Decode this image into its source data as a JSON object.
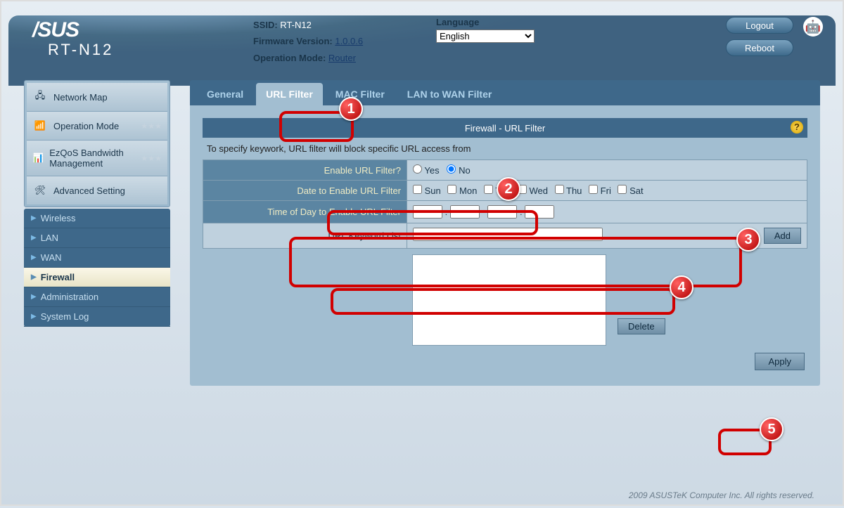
{
  "brand": "/SUS",
  "model": "RT-N12",
  "header": {
    "ssid_label": "SSID:",
    "ssid_value": "RT-N12",
    "fw_label": "Firmware Version:",
    "fw_value": "1.0.0.6",
    "mode_label": "Operation Mode:",
    "mode_value": "Router",
    "lang_label": "Language",
    "lang_value": "English",
    "logout": "Logout",
    "reboot": "Reboot"
  },
  "sidebar": {
    "items": [
      {
        "label": "Network Map"
      },
      {
        "label": "Operation Mode"
      },
      {
        "label": "EzQoS Bandwidth Management"
      },
      {
        "label": "Advanced Setting"
      }
    ],
    "sub": [
      {
        "label": "Wireless"
      },
      {
        "label": "LAN"
      },
      {
        "label": "WAN"
      },
      {
        "label": "Firewall"
      },
      {
        "label": "Administration"
      },
      {
        "label": "System Log"
      }
    ]
  },
  "tabs": [
    {
      "label": "General"
    },
    {
      "label": "URL Filter"
    },
    {
      "label": "MAC Filter"
    },
    {
      "label": "LAN to WAN Filter"
    }
  ],
  "panel": {
    "title": "Firewall - URL Filter",
    "desc": "To specify keywork, URL filter will block specific URL access from",
    "enable_label": "Enable URL Filter?",
    "yes": "Yes",
    "no": "No",
    "date_label": "Date to Enable URL Filter",
    "days": [
      "Sun",
      "Mon",
      "Tue",
      "Wed",
      "Thu",
      "Fri",
      "Sat"
    ],
    "time_label": "Time of Day to Enable URL Filter",
    "keyword_label": "URL Keyword List",
    "add": "Add",
    "delete": "Delete",
    "apply": "Apply"
  },
  "footer": "2009 ASUSTeK Computer Inc. All rights reserved."
}
